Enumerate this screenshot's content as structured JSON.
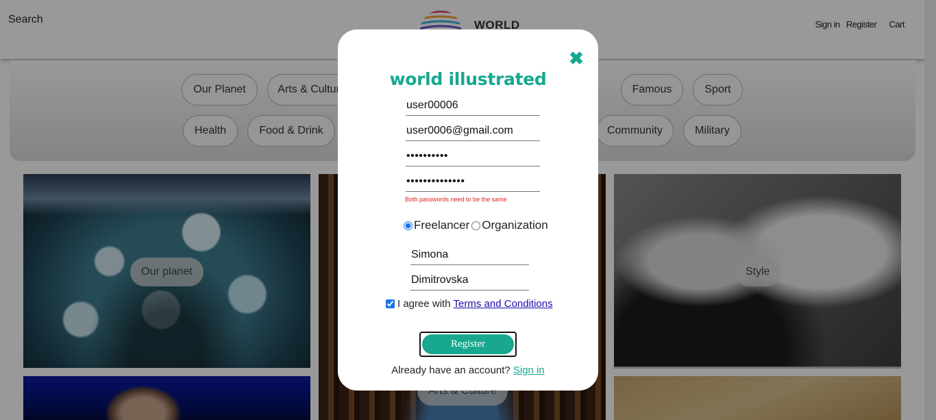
{
  "header": {
    "search_label": "Search",
    "logo_text": "WORLD",
    "sign_in": "Sign in",
    "register": "Register",
    "cart": "Cart"
  },
  "categories": {
    "row1": [
      "Our Planet",
      "Arts & Culture",
      "Famous",
      "Sport"
    ],
    "row2": [
      "Health",
      "Food & Drink",
      "Community",
      "Military"
    ]
  },
  "tiles": {
    "our_planet": "Our planet",
    "style": "Style",
    "arts_culture": "Arts & Culture"
  },
  "modal": {
    "brand": "world illustrated",
    "username": "user00006",
    "email": "user0006@gmail.com",
    "password": "••••••••••",
    "confirm_password": "••••••••••••••",
    "error": "Both passwords need to be the same",
    "radio_freelancer": "Freelancer",
    "radio_organization": "Organization",
    "selected_account_type": "Freelancer",
    "first_name": "Simona",
    "last_name": "Dimitrovska",
    "agree_prefix": "I agree with",
    "terms_link": "Terms and Conditions",
    "register_button": "Register",
    "already_text": "Already have an account?",
    "sign_in_link": "Sign in"
  },
  "colors": {
    "accent": "#17a88f",
    "error": "#e0201c",
    "link": "#1a0dab"
  }
}
